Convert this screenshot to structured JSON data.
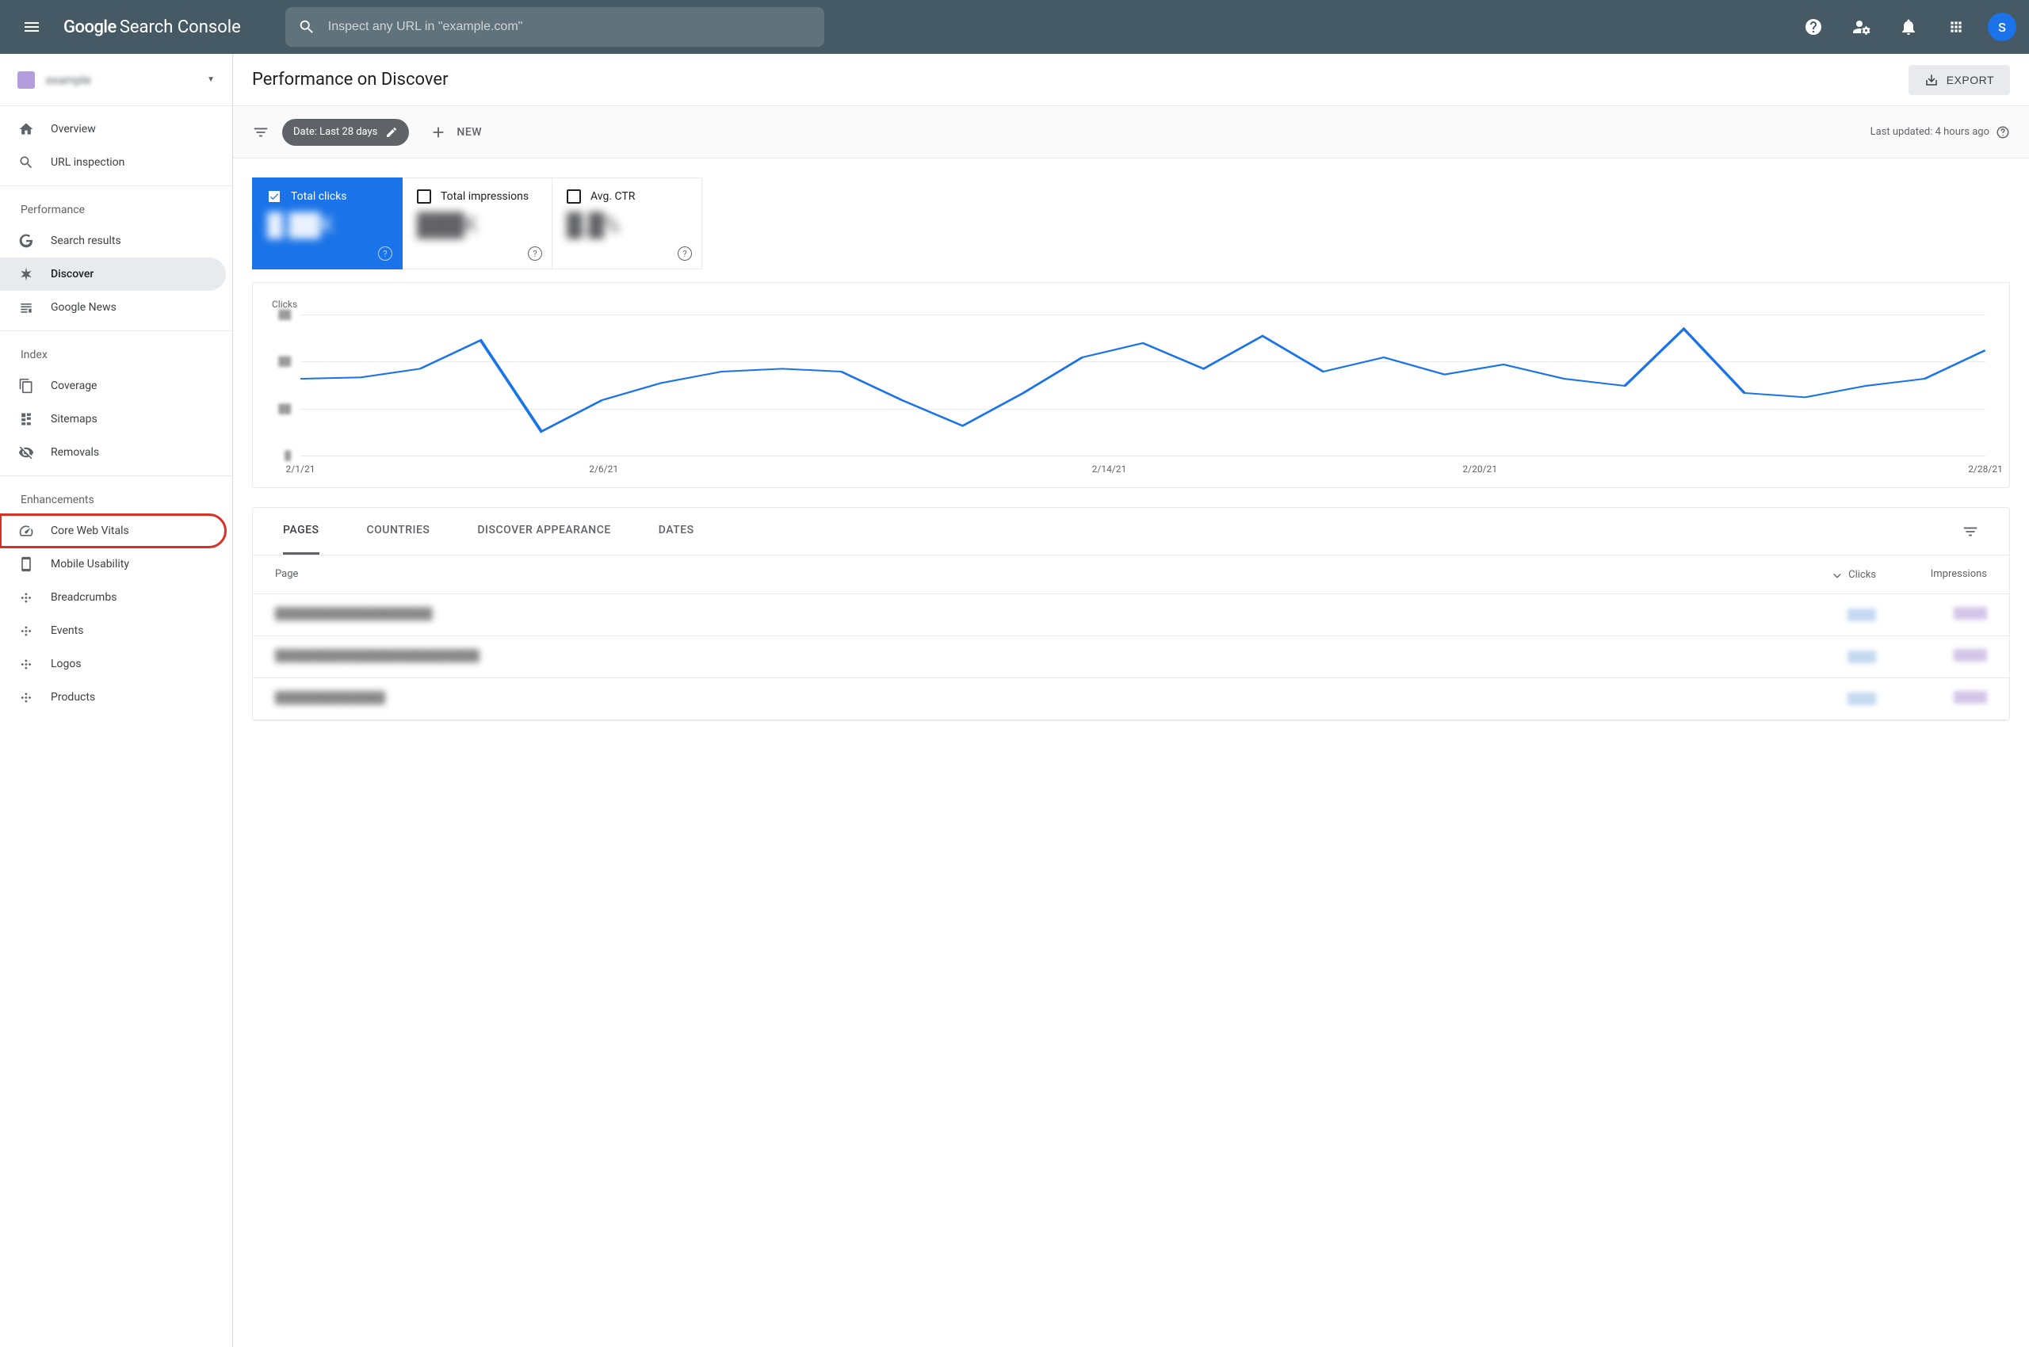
{
  "header": {
    "logo_google": "Google",
    "logo_product": "Search Console",
    "search_placeholder": "Inspect any URL in \"example.com\"",
    "avatar_letter": "S"
  },
  "sidebar": {
    "property_name": "example",
    "items_top": [
      {
        "label": "Overview",
        "icon": "home"
      },
      {
        "label": "URL inspection",
        "icon": "search"
      }
    ],
    "section_performance": "Performance",
    "items_performance": [
      {
        "label": "Search results",
        "icon": "google"
      },
      {
        "label": "Discover",
        "icon": "asterisk",
        "active": true
      },
      {
        "label": "Google News",
        "icon": "news"
      }
    ],
    "section_index": "Index",
    "items_index": [
      {
        "label": "Coverage",
        "icon": "pages"
      },
      {
        "label": "Sitemaps",
        "icon": "sitemap"
      },
      {
        "label": "Removals",
        "icon": "eye-off"
      }
    ],
    "section_enhancements": "Enhancements",
    "items_enhancements": [
      {
        "label": "Core Web Vitals",
        "icon": "speed",
        "highlighted": true
      },
      {
        "label": "Mobile Usability",
        "icon": "mobile"
      },
      {
        "label": "Breadcrumbs",
        "icon": "diamond"
      },
      {
        "label": "Events",
        "icon": "diamond"
      },
      {
        "label": "Logos",
        "icon": "diamond"
      },
      {
        "label": "Products",
        "icon": "diamond"
      }
    ]
  },
  "page": {
    "title": "Performance on Discover",
    "export_label": "EXPORT",
    "date_filter": "Date: Last 28 days",
    "new_label": "NEW",
    "last_updated": "Last updated: 4 hours ago"
  },
  "metrics": [
    {
      "label": "Total clicks",
      "value": "█.██K",
      "active": true
    },
    {
      "label": "Total impressions",
      "value": "███K",
      "active": false
    },
    {
      "label": "Avg. CTR",
      "value": "█.█%",
      "active": false
    }
  ],
  "chart_data": {
    "type": "line",
    "title": "Clicks",
    "x_ticks": [
      "2/1/21",
      "2/6/21",
      "2/14/21",
      "2/20/21",
      "2/28/21"
    ],
    "y_ticks": [
      "",
      "",
      "",
      ""
    ],
    "series": [
      {
        "name": "Clicks",
        "color": "#1a73e8",
        "points_norm": [
          [
            0.0,
            0.45
          ],
          [
            0.036,
            0.44
          ],
          [
            0.071,
            0.38
          ],
          [
            0.107,
            0.18
          ],
          [
            0.143,
            0.82
          ],
          [
            0.179,
            0.6
          ],
          [
            0.214,
            0.48
          ],
          [
            0.25,
            0.4
          ],
          [
            0.286,
            0.38
          ],
          [
            0.321,
            0.4
          ],
          [
            0.357,
            0.6
          ],
          [
            0.393,
            0.78
          ],
          [
            0.429,
            0.55
          ],
          [
            0.464,
            0.3
          ],
          [
            0.5,
            0.2
          ],
          [
            0.536,
            0.38
          ],
          [
            0.571,
            0.15
          ],
          [
            0.607,
            0.4
          ],
          [
            0.643,
            0.3
          ],
          [
            0.679,
            0.42
          ],
          [
            0.714,
            0.35
          ],
          [
            0.75,
            0.45
          ],
          [
            0.786,
            0.5
          ],
          [
            0.821,
            0.1
          ],
          [
            0.857,
            0.55
          ],
          [
            0.893,
            0.58
          ],
          [
            0.929,
            0.5
          ],
          [
            0.964,
            0.45
          ],
          [
            1.0,
            0.25
          ]
        ]
      }
    ]
  },
  "table": {
    "tabs": [
      "PAGES",
      "COUNTRIES",
      "DISCOVER APPEARANCE",
      "DATES"
    ],
    "active_tab": 0,
    "columns": {
      "page": "Page",
      "clicks": "Clicks",
      "impressions": "Impressions"
    },
    "rows": [
      {
        "page": "████████████████████",
        "clicks": "██",
        "impressions": "███"
      },
      {
        "page": "██████████████████████████",
        "clicks": "██",
        "impressions": "███"
      },
      {
        "page": "██████████████",
        "clicks": "██",
        "impressions": "███"
      }
    ]
  }
}
